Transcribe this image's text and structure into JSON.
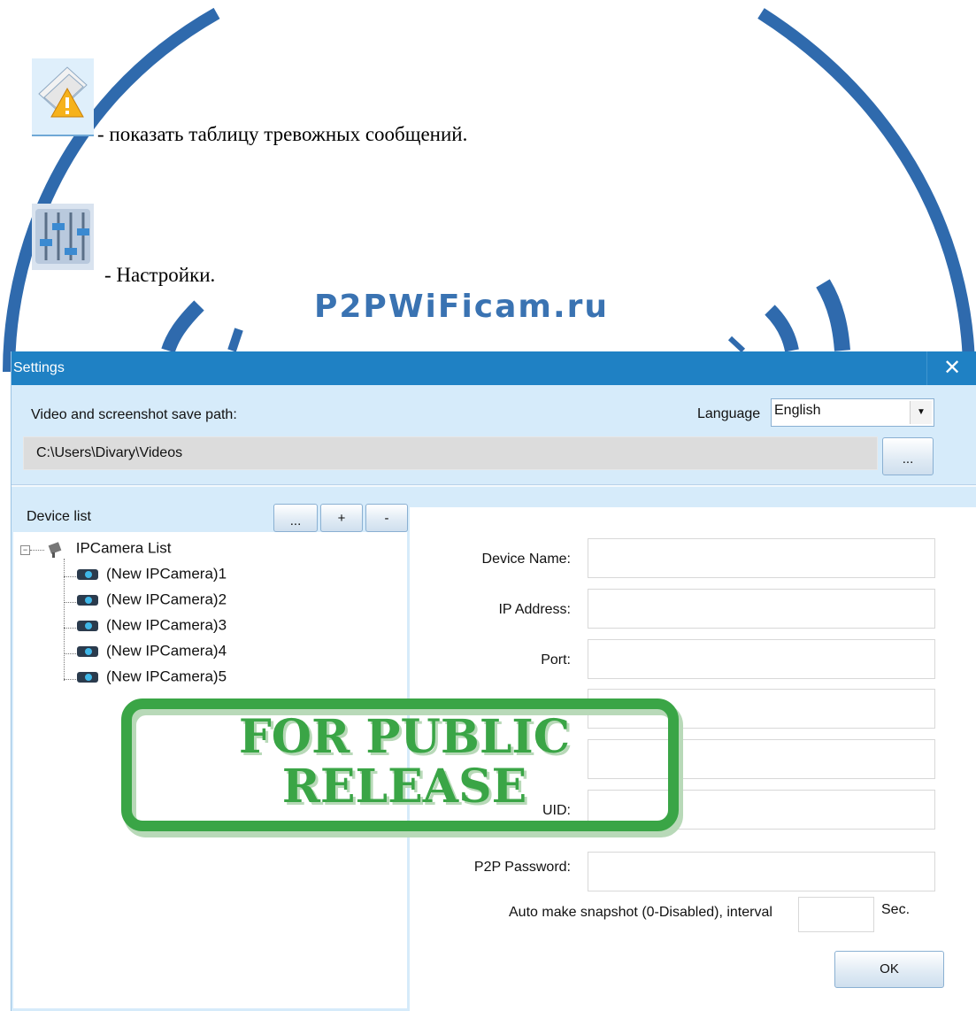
{
  "doc": {
    "line1": "- показать таблицу тревожных сообщений.",
    "line2": "- Настройки.",
    "brand": "P2PWiFicam.ru",
    "icons": [
      "alarm-table-icon",
      "settings-sliders-icon"
    ]
  },
  "settings": {
    "title": "Settings",
    "save_path_label": "Video and screenshot save path:",
    "save_path_value": "C:\\Users\\Divary\\Videos",
    "browse_label": "...",
    "language_label": "Language",
    "language_value": "English",
    "device_list_label": "Device list",
    "device_buttons": [
      "...",
      "+",
      "-"
    ],
    "tree_root": "IPCamera List",
    "cameras": [
      "(New IPCamera)1",
      "(New IPCamera)2",
      "(New IPCamera)3",
      "(New IPCamera)4",
      "(New IPCamera)5"
    ],
    "fields": {
      "device_name": "Device Name:",
      "ip_address": "IP Address:",
      "port": "Port:",
      "p2p_uid": "UID:",
      "p2p_password": "P2P Password:"
    },
    "snapshot_label": "Auto make snapshot (0-Disabled), interval",
    "snapshot_unit": "Sec.",
    "ok_label": "OK"
  },
  "stamp": {
    "line1": "FOR PUBLIC",
    "line2": "RELEASE",
    "color": "#3aa546"
  },
  "colors": {
    "titlebar": "#1f81c4",
    "window_bg": "#d6ebfa",
    "brand": "#3a73b2"
  }
}
